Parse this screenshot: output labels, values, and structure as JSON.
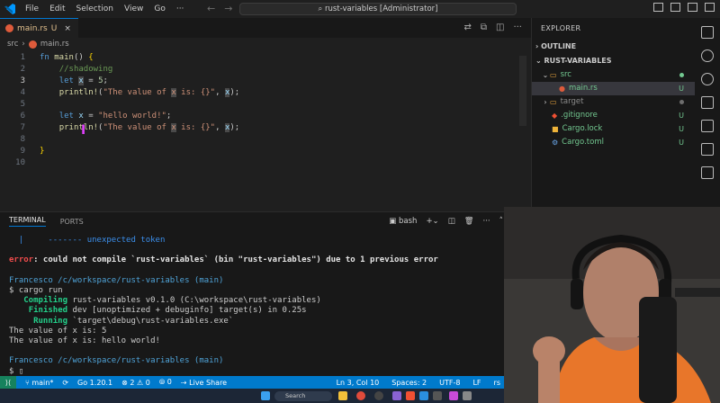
{
  "titlebar": {
    "menu": [
      "File",
      "Edit",
      "Selection",
      "View",
      "Go",
      "···"
    ],
    "command_center": "rust-variables [Administrator]"
  },
  "editor": {
    "tab": {
      "name": "main.rs",
      "badge": "U"
    },
    "breadcrumb": [
      "src",
      "main.rs"
    ],
    "lines": [
      {
        "no": "1",
        "html": "<span class='kw'>fn</span> <span class='fn'>main</span>() <span class='br'>{</span>"
      },
      {
        "no": "2",
        "html": "    <span class='cm'>//shadowing</span>"
      },
      {
        "no": "3",
        "html": "    <span class='kw'>let</span> <span class='var hl'>x</span> = <span class='num'>5</span>;"
      },
      {
        "no": "4",
        "html": "    <span class='mac'>println!</span>(<span class='str'>\"The value of <span class='hl'>x</span> is: {}\"</span>, <span class='var hl'>x</span>);"
      },
      {
        "no": "5",
        "html": ""
      },
      {
        "no": "6",
        "html": "    <span class='kw'>let</span> <span class='var'>x</span> = <span class='str'>\"hello world!\"</span>;"
      },
      {
        "no": "7",
        "html": "    <span class='mac'>println!</span>(<span class='str'>\"The value of <span class='hl'>x</span> is: {}\"</span>, <span class='var hl'>x</span>);"
      },
      {
        "no": "8",
        "html": ""
      },
      {
        "no": "9",
        "html": "<span class='br'>}</span>"
      },
      {
        "no": "10",
        "html": ""
      }
    ]
  },
  "panel": {
    "tabs": [
      "TERMINAL",
      "PORTS"
    ],
    "shell": "bash",
    "terminal_lines": [
      {
        "cls": "t-blue",
        "text": "  |     ------- unexpected token"
      },
      {
        "cls": "t-gray",
        "text": ""
      },
      {
        "cls": "t-gray",
        "html": "<span class='t-red'>error</span><span class='t-white t-bold'>: could not compile `rust-variables` (bin \"rust-variables\") due to 1 previous error</span>"
      },
      {
        "cls": "t-gray",
        "text": ""
      },
      {
        "cls": "t-prompt",
        "text": "Francesco /c/workspace/rust-variables (main)"
      },
      {
        "cls": "t-gray",
        "text": "$ cargo run"
      },
      {
        "cls": "t-gray",
        "html": "   <span class='t-green'>Compiling</span> rust-variables v0.1.0 (C:\\workspace\\rust-variables)"
      },
      {
        "cls": "t-gray",
        "html": "    <span class='t-green'>Finished</span> dev [unoptimized + debuginfo] target(s) in 0.25s"
      },
      {
        "cls": "t-gray",
        "html": "     <span class='t-green'>Running</span> `target\\debug\\rust-variables.exe`"
      },
      {
        "cls": "t-gray",
        "text": "The value of x is: 5"
      },
      {
        "cls": "t-gray",
        "text": "The value of x is: hello world!"
      },
      {
        "cls": "t-gray",
        "text": ""
      },
      {
        "cls": "t-prompt",
        "text": "Francesco /c/workspace/rust-variables (main)"
      },
      {
        "cls": "t-gray",
        "text": "$ ▯"
      }
    ]
  },
  "explorer": {
    "header": "EXPLORER",
    "outline": "OUTLINE",
    "project": "RUST-VARIABLES",
    "items": [
      {
        "label": "src",
        "type": "folder-open",
        "status": "dot",
        "color": "#73c991"
      },
      {
        "label": "main.rs",
        "type": "rust",
        "status": "U",
        "color": "#73c991"
      },
      {
        "label": "target",
        "type": "folder",
        "status": "dotgray",
        "color": "#8b8b8b"
      },
      {
        "label": ".gitignore",
        "type": "git",
        "status": "U",
        "color": "#73c991"
      },
      {
        "label": "Cargo.lock",
        "type": "lock",
        "status": "U",
        "color": "#73c991"
      },
      {
        "label": "Cargo.toml",
        "type": "gear",
        "status": "U",
        "color": "#73c991"
      }
    ]
  },
  "statusbar": {
    "branch": "main*",
    "version": "Go 1.20.1",
    "errors": "2",
    "warnings": "0",
    "ports": "0",
    "liveshare": "Live Share",
    "position": "Ln 3, Col 10",
    "spaces": "Spaces: 2",
    "encoding": "UTF-8",
    "eol": "LF",
    "language": "rs"
  },
  "taskbar": {
    "search": "Search"
  }
}
